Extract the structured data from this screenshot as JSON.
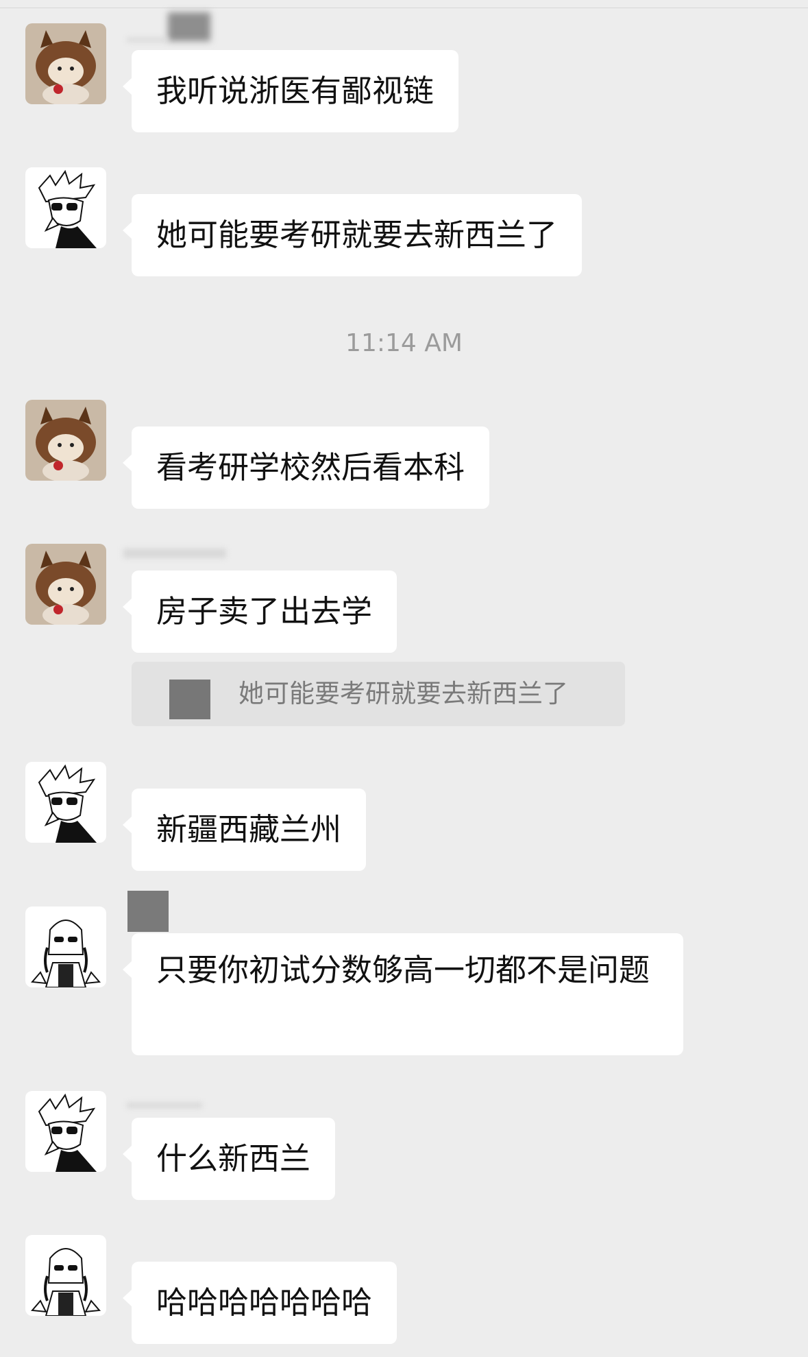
{
  "timestamp": "11:14 AM",
  "messages": [
    {
      "text": "我听说浙医有鄙视链"
    },
    {
      "text": "她可能要考研就要去新西兰了"
    },
    {
      "text": "看考研学校然后看本科"
    },
    {
      "text": "房子卖了出去学"
    },
    {
      "text": "新疆西藏兰州"
    },
    {
      "text": "只要你初试分数够高一切都不是问题"
    },
    {
      "text": "什么新西兰"
    },
    {
      "text": "哈哈哈哈哈哈哈"
    }
  ],
  "quote": {
    "text": "她可能要考研就要去新西兰了"
  },
  "colors": {
    "background": "#ededed",
    "bubble": "#ffffff",
    "quote": "#e2e2e2"
  }
}
